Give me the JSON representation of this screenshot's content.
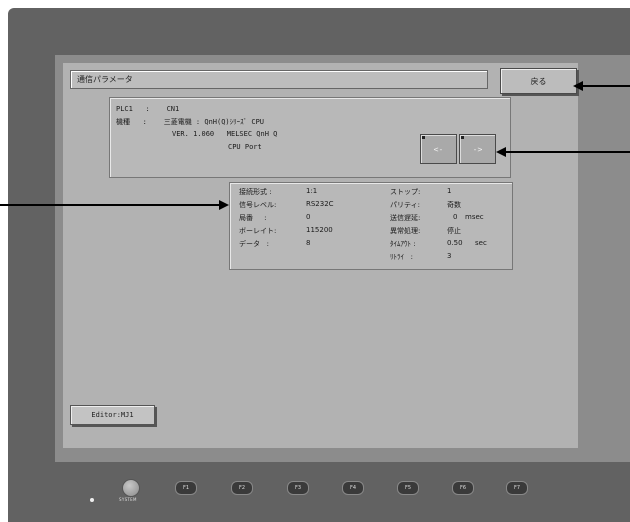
{
  "title": "通信パラメータ",
  "back_label": "戻る",
  "plc": {
    "row1": "PLC1   :    CN1",
    "row2": "機種   :    三菱電機 : QnH(Q)ｼﾘｰｽﾞ CPU",
    "row3": "VER. 1.060   MELSEC QnH Q",
    "row4": "CPU Port"
  },
  "nav": {
    "prev_label": "<-",
    "next_label": "->"
  },
  "params": {
    "left": [
      {
        "label": "接続形式 :",
        "value": "1:1"
      },
      {
        "label": "信号レベル:",
        "value": "RS232C"
      },
      {
        "label": "局番     :",
        "value": "0"
      },
      {
        "label": "ボーレイト:",
        "value": "115200"
      },
      {
        "label": "データ   :",
        "value": "8"
      }
    ],
    "right": [
      {
        "label": "ストップ:",
        "value": "1",
        "unit": ""
      },
      {
        "label": "パリティ:",
        "value": "奇数",
        "unit": ""
      },
      {
        "label": "送信遅延:",
        "value": "0",
        "unit": "msec"
      },
      {
        "label": "異常処理:",
        "value": "停止",
        "unit": ""
      },
      {
        "label": "ﾀｲﾑｱｳﾄ :",
        "value": "0.50",
        "unit": "sec"
      },
      {
        "label": "ﾘﾄﾗｲ   :",
        "value": "3",
        "unit": ""
      }
    ]
  },
  "editor_label": "Editor:MJ1",
  "system_label": "SYSTEM",
  "fkeys": [
    "F1",
    "F2",
    "F3",
    "F4",
    "F5",
    "F6",
    "F7"
  ]
}
